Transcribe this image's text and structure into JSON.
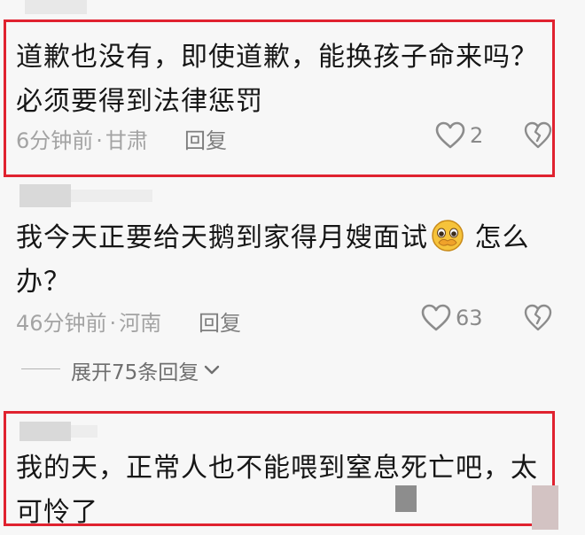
{
  "comments": [
    {
      "text": "道歉也没有，即使道歉，能换孩子命来吗？必须要得到法律惩罚",
      "time": "6分钟前",
      "location": "甘肃",
      "reply_label": "回复",
      "likes": "2"
    },
    {
      "text_before_emoji": "我今天正要给天鹅到家得月嫂面试",
      "emoji": "crying-face-emoji",
      "text_after_emoji": " 怎么办？",
      "time": "46分钟前",
      "location": "河南",
      "reply_label": "回复",
      "likes": "63",
      "expand_label": "展开75条回复"
    },
    {
      "text": "我的天，正常人也不能喂到窒息死亡吧，太可怜了"
    }
  ],
  "separator": "·",
  "colors": {
    "highlight_border": "#e0222f",
    "meta_text": "#a3a3a3",
    "background": "#f7f7f7"
  },
  "icons": [
    "heart-icon",
    "broken-heart-icon",
    "chevron-down-icon"
  ]
}
